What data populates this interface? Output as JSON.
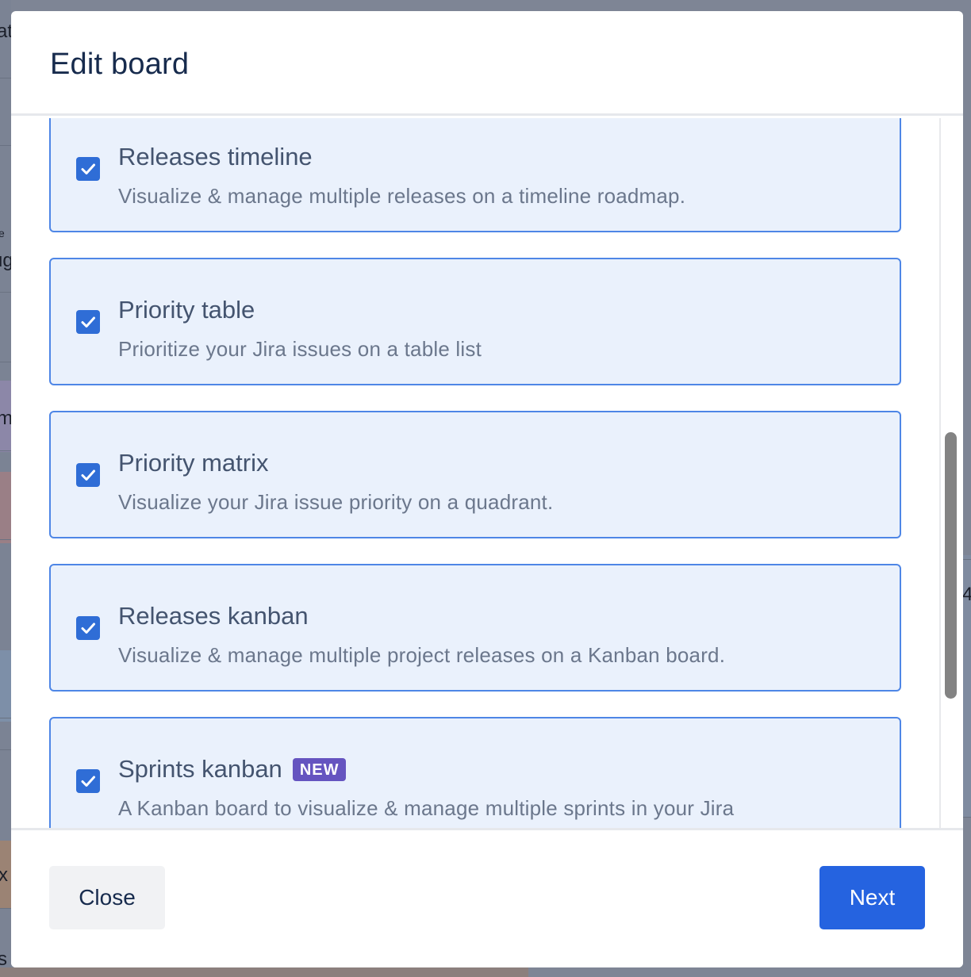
{
  "modal": {
    "title": "Edit board"
  },
  "options": [
    {
      "title": "Releases timeline",
      "description": "Visualize & manage multiple releases on a timeline roadmap.",
      "checked": true
    },
    {
      "title": "Priority table",
      "description": "Prioritize your Jira issues on a table list",
      "checked": true
    },
    {
      "title": "Priority matrix",
      "description": "Visualize your Jira issue priority on a quadrant.",
      "checked": true
    },
    {
      "title": "Releases kanban",
      "description": "Visualize & manage multiple project releases on a Kanban board.",
      "checked": true
    },
    {
      "title": "Sprints kanban",
      "badge": "NEW",
      "description": "A Kanban board to visualize & manage multiple sprints in your Jira",
      "checked": true
    }
  ],
  "footer": {
    "close_label": "Close",
    "next_label": "Next"
  },
  "background_fragments": {
    "a": "at",
    "e": "e",
    "g": "ug",
    "m": "m",
    "num": "4",
    "x": "x",
    "s": "s"
  },
  "colors": {
    "accent": "#2563e0",
    "card_bg": "#eaf1fc",
    "card_border": "#4e86e6",
    "checkbox": "#2f6dd6",
    "badge": "#6554c0",
    "title_text": "#172b4d"
  },
  "icons": {
    "checkbox": "check-icon"
  }
}
